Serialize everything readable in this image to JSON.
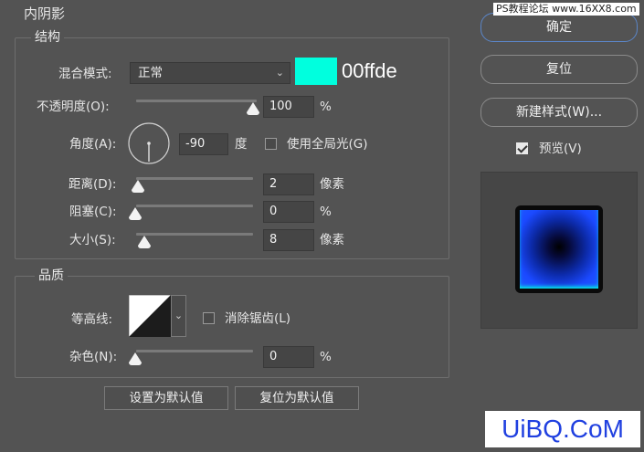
{
  "panel": {
    "title": "内阴影",
    "structure": {
      "legend": "结构",
      "blend_mode_label": "混合模式:",
      "blend_mode_value": "正常",
      "color_hex": "#00ffde",
      "color_caption": "00ffde",
      "opacity_label": "不透明度(O):",
      "opacity_value": "100",
      "opacity_unit": "%",
      "opacity_level": 1.0,
      "angle_label": "角度(A):",
      "angle_value": "-90",
      "angle_unit": "度",
      "global_light_label": "使用全局光(G)",
      "global_light_checked": false,
      "distance_label": "距离(D):",
      "distance_value": "2",
      "distance_unit": "像素",
      "choke_label": "阻塞(C):",
      "choke_value": "0",
      "choke_unit": "%",
      "size_label": "大小(S):",
      "size_value": "8",
      "size_unit": "像素"
    },
    "quality": {
      "legend": "品质",
      "contour_label": "等高线:",
      "antialias_label": "消除锯齿(L)",
      "antialias_checked": false,
      "noise_label": "杂色(N):",
      "noise_value": "0",
      "noise_unit": "%"
    },
    "make_default_label": "设置为默认值",
    "reset_default_label": "复位为默认值"
  },
  "side": {
    "ok_label": "确定",
    "reset_label": "复位",
    "new_style_label": "新建样式(W)...",
    "preview_label": "预览(V)",
    "preview_checked": true
  },
  "watermarks": {
    "top": "PS教程论坛 www.16XX8.com",
    "bottom": "UiBQ.CoM"
  },
  "colors": {
    "bg": "#535353",
    "accent_border": "#5b86c8",
    "swatch": "#00ffde",
    "preview_blue": "#1b49ff",
    "watermark_blue": "#2040e0"
  }
}
